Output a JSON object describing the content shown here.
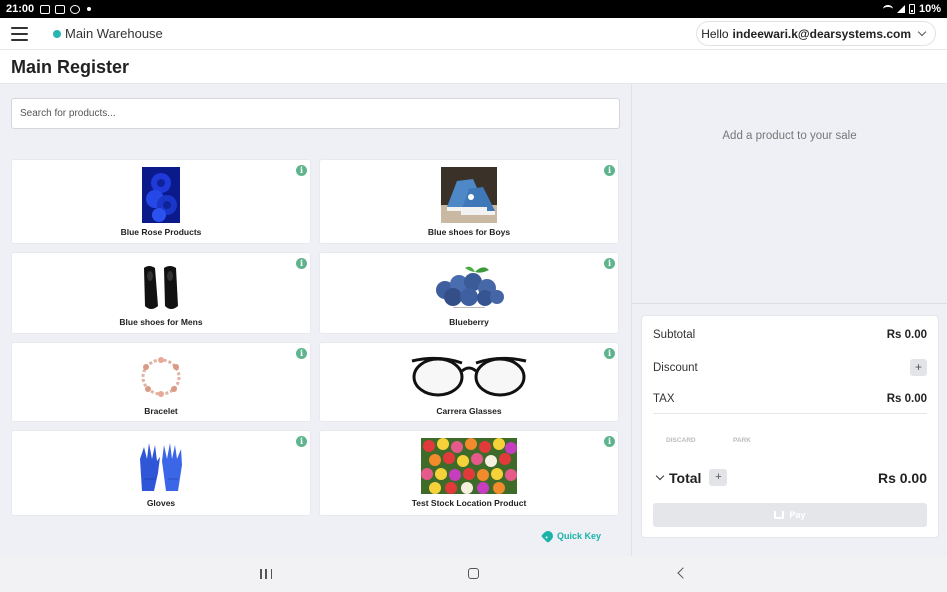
{
  "status_bar": {
    "time": "21:00",
    "battery": "10%"
  },
  "header": {
    "warehouse": "Main Warehouse",
    "hello": "Hello",
    "email": "indeewari.k@dearsystems.com"
  },
  "page": {
    "title": "Main Register"
  },
  "search": {
    "placeholder": "Search for products..."
  },
  "products": [
    {
      "name": "Blue Rose Products",
      "icon": "blue-rose-image"
    },
    {
      "name": "Blue shoes for Boys",
      "icon": "sneakers-image"
    },
    {
      "name": "Blue shoes for Mens",
      "icon": "dress-shoes-image"
    },
    {
      "name": "Blueberry",
      "icon": "blueberry-image"
    },
    {
      "name": "Bracelet",
      "icon": "bracelet-image"
    },
    {
      "name": "Carrera Glasses",
      "icon": "glasses-image"
    },
    {
      "name": "Gloves",
      "icon": "gloves-image"
    },
    {
      "name": "Test Stock Location Product",
      "icon": "tulips-image"
    }
  ],
  "info_icon_text": "i",
  "quick_key": "Quick Key",
  "sale": {
    "empty_message": "Add a product to your sale",
    "subtotal_label": "Subtotal",
    "subtotal_value": "Rs 0.00",
    "discount_label": "Discount",
    "tax_label": "TAX",
    "tax_value": "Rs 0.00",
    "discard_label": "DISCARD",
    "park_label": "PARK",
    "total_label": "Total",
    "total_value": "Rs 0.00",
    "pay_label": "Pay",
    "plus": "+"
  },
  "colors": {
    "accent": "#1ab3a8",
    "info_badge": "#5fb48e",
    "panel_bg": "#eef0f6"
  }
}
